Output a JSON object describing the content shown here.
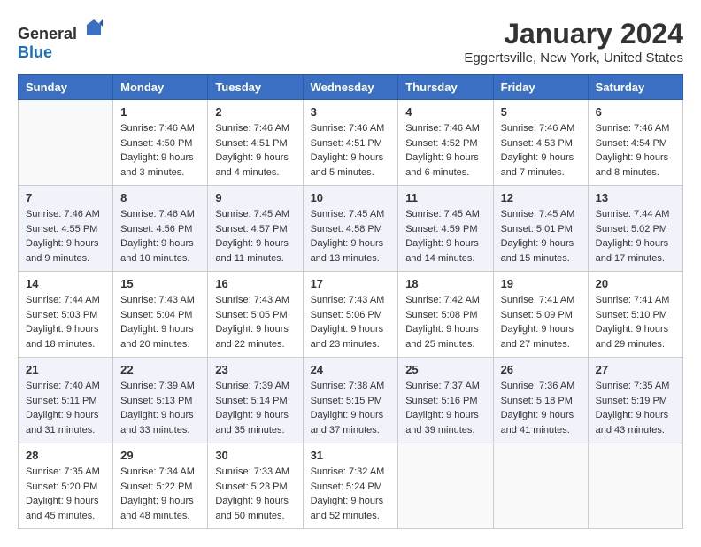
{
  "header": {
    "logo_general": "General",
    "logo_blue": "Blue",
    "title": "January 2024",
    "subtitle": "Eggertsville, New York, United States"
  },
  "calendar": {
    "days_of_week": [
      "Sunday",
      "Monday",
      "Tuesday",
      "Wednesday",
      "Thursday",
      "Friday",
      "Saturday"
    ],
    "weeks": [
      [
        {
          "day": "",
          "sunrise": "",
          "sunset": "",
          "daylight": ""
        },
        {
          "day": "1",
          "sunrise": "Sunrise: 7:46 AM",
          "sunset": "Sunset: 4:50 PM",
          "daylight": "Daylight: 9 hours and 3 minutes."
        },
        {
          "day": "2",
          "sunrise": "Sunrise: 7:46 AM",
          "sunset": "Sunset: 4:51 PM",
          "daylight": "Daylight: 9 hours and 4 minutes."
        },
        {
          "day": "3",
          "sunrise": "Sunrise: 7:46 AM",
          "sunset": "Sunset: 4:51 PM",
          "daylight": "Daylight: 9 hours and 5 minutes."
        },
        {
          "day": "4",
          "sunrise": "Sunrise: 7:46 AM",
          "sunset": "Sunset: 4:52 PM",
          "daylight": "Daylight: 9 hours and 6 minutes."
        },
        {
          "day": "5",
          "sunrise": "Sunrise: 7:46 AM",
          "sunset": "Sunset: 4:53 PM",
          "daylight": "Daylight: 9 hours and 7 minutes."
        },
        {
          "day": "6",
          "sunrise": "Sunrise: 7:46 AM",
          "sunset": "Sunset: 4:54 PM",
          "daylight": "Daylight: 9 hours and 8 minutes."
        }
      ],
      [
        {
          "day": "7",
          "sunrise": "Sunrise: 7:46 AM",
          "sunset": "Sunset: 4:55 PM",
          "daylight": "Daylight: 9 hours and 9 minutes."
        },
        {
          "day": "8",
          "sunrise": "Sunrise: 7:46 AM",
          "sunset": "Sunset: 4:56 PM",
          "daylight": "Daylight: 9 hours and 10 minutes."
        },
        {
          "day": "9",
          "sunrise": "Sunrise: 7:45 AM",
          "sunset": "Sunset: 4:57 PM",
          "daylight": "Daylight: 9 hours and 11 minutes."
        },
        {
          "day": "10",
          "sunrise": "Sunrise: 7:45 AM",
          "sunset": "Sunset: 4:58 PM",
          "daylight": "Daylight: 9 hours and 13 minutes."
        },
        {
          "day": "11",
          "sunrise": "Sunrise: 7:45 AM",
          "sunset": "Sunset: 4:59 PM",
          "daylight": "Daylight: 9 hours and 14 minutes."
        },
        {
          "day": "12",
          "sunrise": "Sunrise: 7:45 AM",
          "sunset": "Sunset: 5:01 PM",
          "daylight": "Daylight: 9 hours and 15 minutes."
        },
        {
          "day": "13",
          "sunrise": "Sunrise: 7:44 AM",
          "sunset": "Sunset: 5:02 PM",
          "daylight": "Daylight: 9 hours and 17 minutes."
        }
      ],
      [
        {
          "day": "14",
          "sunrise": "Sunrise: 7:44 AM",
          "sunset": "Sunset: 5:03 PM",
          "daylight": "Daylight: 9 hours and 18 minutes."
        },
        {
          "day": "15",
          "sunrise": "Sunrise: 7:43 AM",
          "sunset": "Sunset: 5:04 PM",
          "daylight": "Daylight: 9 hours and 20 minutes."
        },
        {
          "day": "16",
          "sunrise": "Sunrise: 7:43 AM",
          "sunset": "Sunset: 5:05 PM",
          "daylight": "Daylight: 9 hours and 22 minutes."
        },
        {
          "day": "17",
          "sunrise": "Sunrise: 7:43 AM",
          "sunset": "Sunset: 5:06 PM",
          "daylight": "Daylight: 9 hours and 23 minutes."
        },
        {
          "day": "18",
          "sunrise": "Sunrise: 7:42 AM",
          "sunset": "Sunset: 5:08 PM",
          "daylight": "Daylight: 9 hours and 25 minutes."
        },
        {
          "day": "19",
          "sunrise": "Sunrise: 7:41 AM",
          "sunset": "Sunset: 5:09 PM",
          "daylight": "Daylight: 9 hours and 27 minutes."
        },
        {
          "day": "20",
          "sunrise": "Sunrise: 7:41 AM",
          "sunset": "Sunset: 5:10 PM",
          "daylight": "Daylight: 9 hours and 29 minutes."
        }
      ],
      [
        {
          "day": "21",
          "sunrise": "Sunrise: 7:40 AM",
          "sunset": "Sunset: 5:11 PM",
          "daylight": "Daylight: 9 hours and 31 minutes."
        },
        {
          "day": "22",
          "sunrise": "Sunrise: 7:39 AM",
          "sunset": "Sunset: 5:13 PM",
          "daylight": "Daylight: 9 hours and 33 minutes."
        },
        {
          "day": "23",
          "sunrise": "Sunrise: 7:39 AM",
          "sunset": "Sunset: 5:14 PM",
          "daylight": "Daylight: 9 hours and 35 minutes."
        },
        {
          "day": "24",
          "sunrise": "Sunrise: 7:38 AM",
          "sunset": "Sunset: 5:15 PM",
          "daylight": "Daylight: 9 hours and 37 minutes."
        },
        {
          "day": "25",
          "sunrise": "Sunrise: 7:37 AM",
          "sunset": "Sunset: 5:16 PM",
          "daylight": "Daylight: 9 hours and 39 minutes."
        },
        {
          "day": "26",
          "sunrise": "Sunrise: 7:36 AM",
          "sunset": "Sunset: 5:18 PM",
          "daylight": "Daylight: 9 hours and 41 minutes."
        },
        {
          "day": "27",
          "sunrise": "Sunrise: 7:35 AM",
          "sunset": "Sunset: 5:19 PM",
          "daylight": "Daylight: 9 hours and 43 minutes."
        }
      ],
      [
        {
          "day": "28",
          "sunrise": "Sunrise: 7:35 AM",
          "sunset": "Sunset: 5:20 PM",
          "daylight": "Daylight: 9 hours and 45 minutes."
        },
        {
          "day": "29",
          "sunrise": "Sunrise: 7:34 AM",
          "sunset": "Sunset: 5:22 PM",
          "daylight": "Daylight: 9 hours and 48 minutes."
        },
        {
          "day": "30",
          "sunrise": "Sunrise: 7:33 AM",
          "sunset": "Sunset: 5:23 PM",
          "daylight": "Daylight: 9 hours and 50 minutes."
        },
        {
          "day": "31",
          "sunrise": "Sunrise: 7:32 AM",
          "sunset": "Sunset: 5:24 PM",
          "daylight": "Daylight: 9 hours and 52 minutes."
        },
        {
          "day": "",
          "sunrise": "",
          "sunset": "",
          "daylight": ""
        },
        {
          "day": "",
          "sunrise": "",
          "sunset": "",
          "daylight": ""
        },
        {
          "day": "",
          "sunrise": "",
          "sunset": "",
          "daylight": ""
        }
      ]
    ]
  }
}
